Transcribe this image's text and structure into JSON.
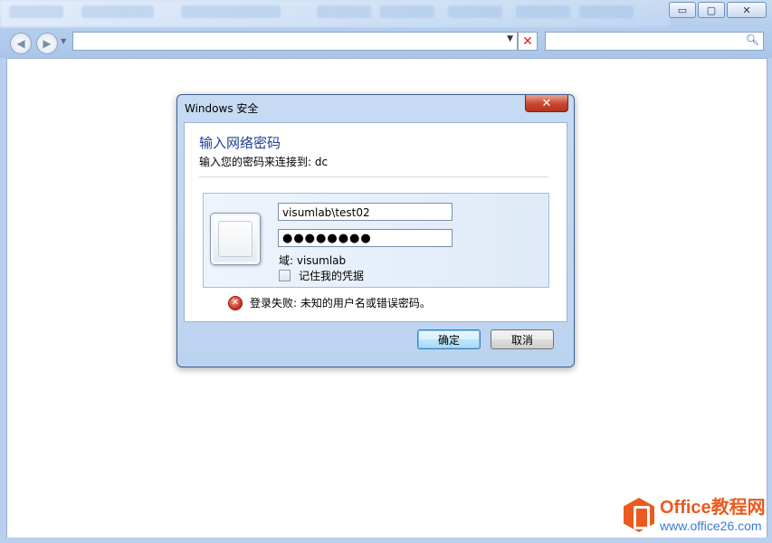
{
  "browser": {
    "window_buttons": {
      "minimize": "▭",
      "maximize": "▢",
      "close": "✕"
    },
    "nav": {
      "back_icon": "back-arrow-icon",
      "forward_icon": "forward-arrow-icon"
    },
    "address_value": "",
    "search_value": ""
  },
  "dialog": {
    "title": "Windows 安全",
    "heading": "输入网络密码",
    "subheading": "输入您的密码来连接到: dc",
    "username": "visumlab\\test02",
    "password_mask": "●●●●●●●●",
    "domain": "域: visumlab",
    "remember_label": "记住我的凭据",
    "remember_checked": false,
    "error_text": "登录失败: 未知的用户名或错误密码。",
    "ok_label": "确定",
    "cancel_label": "取消"
  },
  "watermark": {
    "title": "Office教程网",
    "url": "www.office26.com"
  },
  "colors": {
    "accent": "#1e3f94",
    "error": "#c82a1a",
    "watermark_orange": "#eb5a1e",
    "watermark_blue": "#3a7bd5"
  }
}
